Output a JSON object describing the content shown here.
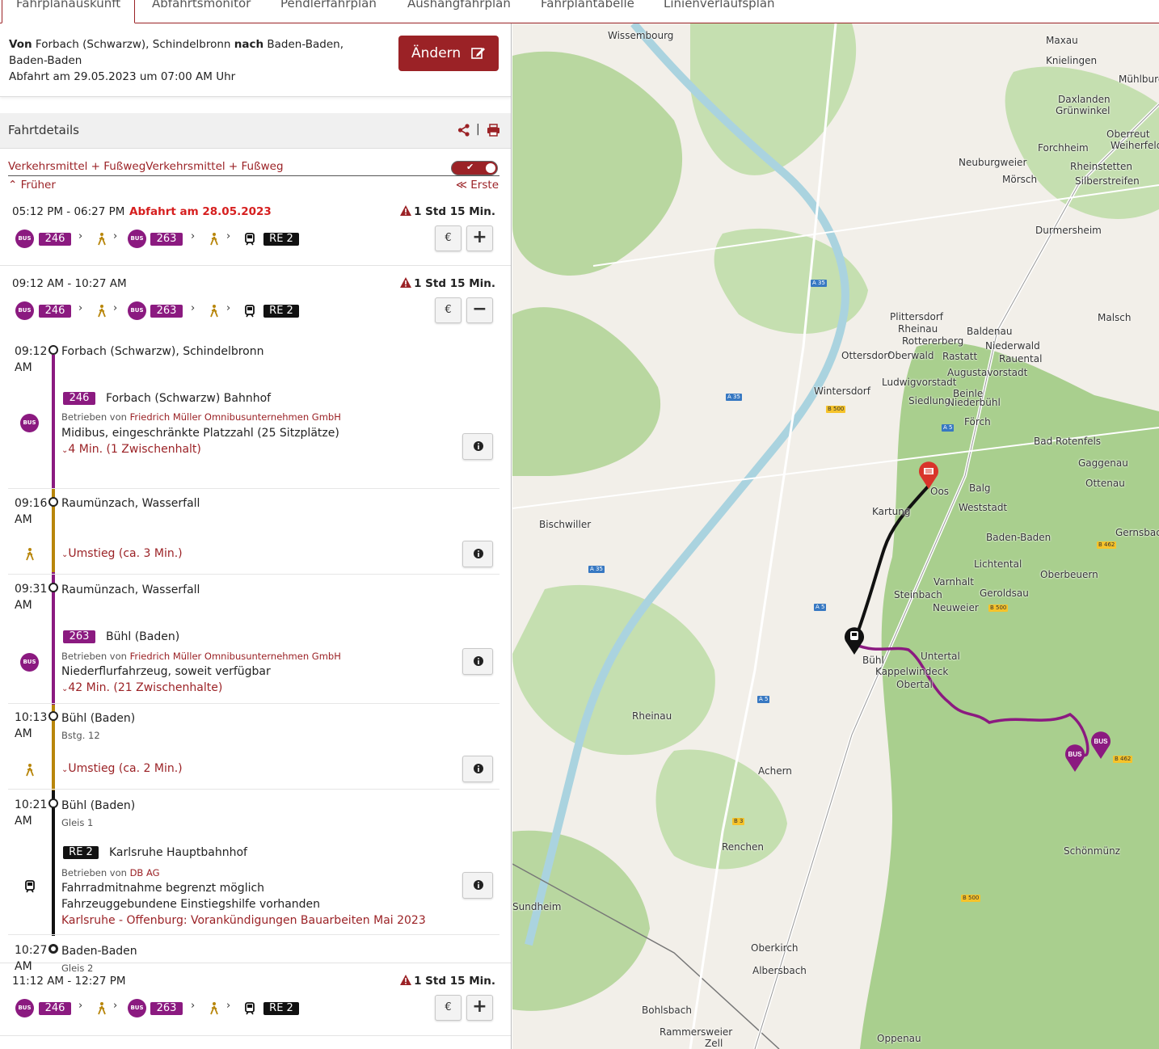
{
  "tabs": [
    "Fahrplanauskunft",
    "Abfahrtsmonitor",
    "Pendlerfahrplan",
    "Aushangfahrplan",
    "Fahrplantabelle",
    "Linienverlaufsplan"
  ],
  "search": {
    "from_label": "Von",
    "from": "Forbach (Schwarzw), Schindelbronn",
    "to_label": "nach",
    "to": "Baden-Baden, Baden-Baden",
    "departure": "Abfahrt am 29.05.2023 um 07:00 AM Uhr",
    "change_button": "Ändern"
  },
  "details": {
    "title": "Fahrtdetails",
    "separator": "|",
    "filter_label": "Verkehrsmittel + FußwegVerkehrsmittel + Fußweg",
    "earlier": "Früher",
    "first": "Erste"
  },
  "common": {
    "bus_icon": "BUS",
    "line1": "246",
    "line2": "263",
    "train": "RE 2",
    "euro": "€",
    "plus": "+",
    "minus": "−",
    "chevron": "›",
    "duration": "1 Std 15 Min."
  },
  "trips": [
    {
      "time": "05:12 PM - 06:27 PM",
      "warning": "Abfahrt am 28.05.2023",
      "expanded": false
    },
    {
      "time": "09:12 AM - 10:27 AM",
      "warning": "",
      "expanded": true
    },
    {
      "time": "11:12 AM - 12:27 PM",
      "warning": "",
      "expanded": false
    }
  ],
  "legs": {
    "t1": "09:12 AM",
    "s1": "Forbach (Schwarzw), Schindelbronn",
    "l1_dest": "Forbach (Schwarzw) Bahnhof",
    "operated_prefix": "Betrieben von",
    "operator_bus": "Friedrich Müller Omnibusunternehmen GmbH",
    "l1_vehicle": "Midibus, eingeschränkte Platzzahl (25 Sitzplätze)",
    "l1_stops": "4 Min. (1 Zwischenhalt)",
    "t2": "09:16 AM",
    "s2": "Raumünzach, Wasserfall",
    "transfer1": "Umstieg (ca. 3 Min.)",
    "t3": "09:31 AM",
    "s3": "Raumünzach, Wasserfall",
    "l2_dest": "Bühl (Baden)",
    "l2_vehicle": "Niederflurfahrzeug, soweit verfügbar",
    "l2_stops": "42 Min. (21 Zwischenhalte)",
    "t4": "10:13 AM",
    "s4": "Bühl (Baden)",
    "s4_sub": "Bstg. 12",
    "transfer2": "Umstieg (ca. 2 Min.)",
    "t5": "10:21 AM",
    "s5": "Bühl (Baden)",
    "s5_sub": "Gleis 1",
    "l3_dest": "Karlsruhe Hauptbahnhof",
    "operator_train": "DB AG",
    "l3_note1": "Fahrradmitnahme begrenzt möglich",
    "l3_note2": "Fahrzeuggebundene Einstiegshilfe vorhanden",
    "l3_notice": "Karlsruhe - Offenburg: Vorankündigungen Bauarbeiten Mai 2023",
    "t6": "10:27 AM",
    "s6": "Baden-Baden",
    "s6_sub": "Gleis 2"
  },
  "map": {
    "places": [
      "Wissembourg",
      "Maxau",
      "Knielingen",
      "Mühlburg",
      "Daxlanden",
      "Grünwinkel",
      "Oberreut",
      "Weiherfeld",
      "Forchheim",
      "Neuburgweier",
      "Mörsch",
      "Rheinstetten",
      "Silberstreifen",
      "Durmersheim",
      "Malsch",
      "Plittersdorf",
      "Rheinau",
      "Rottererberg",
      "Baldenau",
      "Niederwald",
      "Ottersdorf",
      "Oberwald",
      "Rastatt",
      "Rauental",
      "Augustavorstadt",
      "Ludwigvorstadt",
      "Wintersdorf",
      "Beinle",
      "Niederbühl",
      "Siedlung",
      "Förch",
      "Bad Rotenfels",
      "Gaggenau",
      "Ottenau",
      "Oos",
      "Balg",
      "Weststadt",
      "Kartung",
      "Bischwiller",
      "Baden-Baden",
      "Lichtental",
      "Gernsbach",
      "Oberbeuern",
      "Varnhalt",
      "Geroldsau",
      "Steinbach",
      "Neuweier",
      "Bühl",
      "Untertal",
      "Kappelwindeck",
      "Obertal",
      "Rheinau",
      "Achern",
      "Renchen",
      "Schönmünz",
      "Oberkirch",
      "Albersbach",
      "Bohlsbach",
      "Rammersweier",
      "Oppenau",
      "Zell",
      "Sundheim",
      "Fahrplanauskunft"
    ],
    "accent": "#9b2226",
    "bus_color": "#8b1a80",
    "train_color": "#111111"
  }
}
